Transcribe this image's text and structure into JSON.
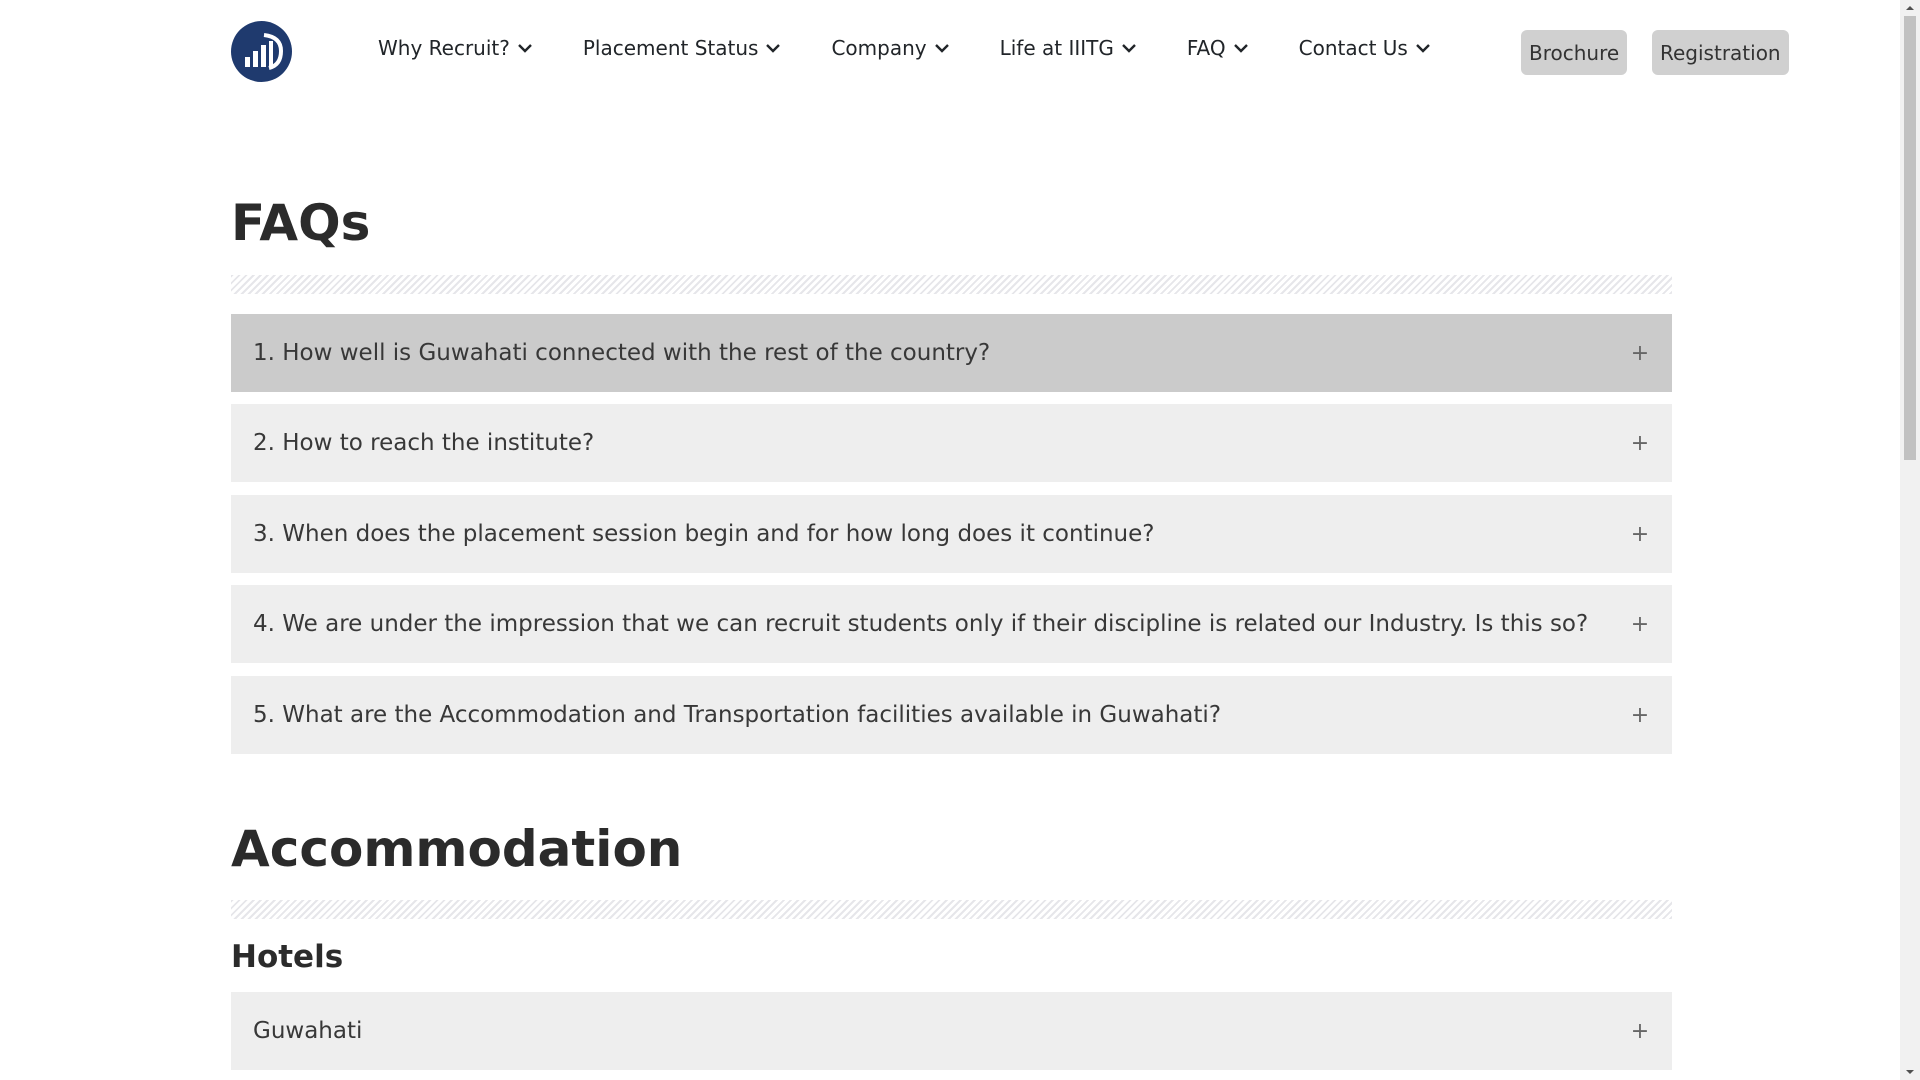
{
  "nav": {
    "items": [
      {
        "label": "Why Recruit?"
      },
      {
        "label": "Placement Status"
      },
      {
        "label": "Company"
      },
      {
        "label": "Life at IIITG"
      },
      {
        "label": "FAQ"
      },
      {
        "label": "Contact Us"
      }
    ],
    "brochure_label": "Brochure",
    "registration_label": "Registration"
  },
  "faqs": {
    "title": "FAQs",
    "items": [
      {
        "question": "1. How well is Guwahati connected with the rest of the country?",
        "expanded": false
      },
      {
        "question": "2. How to reach the institute?",
        "expanded": false
      },
      {
        "question": "3. When does the placement session begin and for how long does it continue?",
        "expanded": false
      },
      {
        "question": "4. We are under the impression that we can recruit students only if their discipline is related our Industry. Is this so?",
        "expanded": false
      },
      {
        "question": "5. What are the Accommodation and Transportation facilities available in Guwahati?",
        "expanded": false
      }
    ],
    "toggle_symbol": "+"
  },
  "accommodation": {
    "title": "Accommodation",
    "hotels_title": "Hotels",
    "items": [
      {
        "label": "Guwahati"
      }
    ]
  },
  "colors": {
    "logo": "#1f3a6e",
    "faq_bg": "#eeeeee",
    "faq_active_bg": "#cbcbcb",
    "button_bg": "#d0d0d0"
  },
  "icons": {
    "logo": "bar-chart-logo-icon",
    "nav_dropdown": "chevron-down-icon",
    "faq_toggle": "plus-icon"
  }
}
